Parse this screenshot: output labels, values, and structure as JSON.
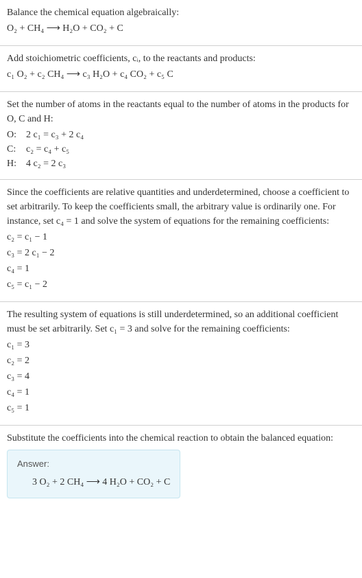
{
  "section1": {
    "line1": "Balance the chemical equation algebraically:",
    "eq": "O₂ + CH₄ ⟶ H₂O + CO₂ + C"
  },
  "section2": {
    "line1": "Add stoichiometric coefficients, cᵢ, to the reactants and products:",
    "eq": "c₁ O₂ + c₂ CH₄ ⟶ c₃ H₂O + c₄ CO₂ + c₅ C"
  },
  "section3": {
    "line1": "Set the number of atoms in the reactants equal to the number of atoms in the products for O, C and H:",
    "oLabel": "O:",
    "oEq": "2 c₁ = c₃ + 2 c₄",
    "cLabel": "C:",
    "cEq": "c₂ = c₄ + c₅",
    "hLabel": "H:",
    "hEq": "4 c₂ = 2 c₃"
  },
  "section4": {
    "line1": "Since the coefficients are relative quantities and underdetermined, choose a coefficient to set arbitrarily. To keep the coefficients small, the arbitrary value is ordinarily one. For instance, set c₄ = 1 and solve the system of equations for the remaining coefficients:",
    "l1": "c₂ = c₁ − 1",
    "l2": "c₃ = 2 c₁ − 2",
    "l3": "c₄ = 1",
    "l4": "c₅ = c₁ − 2"
  },
  "section5": {
    "line1": "The resulting system of equations is still underdetermined, so an additional coefficient must be set arbitrarily. Set c₁ = 3 and solve for the remaining coefficients:",
    "l1": "c₁ = 3",
    "l2": "c₂ = 2",
    "l3": "c₃ = 4",
    "l4": "c₄ = 1",
    "l5": "c₅ = 1"
  },
  "section6": {
    "line1": "Substitute the coefficients into the chemical reaction to obtain the balanced equation:",
    "answerLabel": "Answer:",
    "answerEq": "3 O₂ + 2 CH₄ ⟶ 4 H₂O + CO₂ + C"
  }
}
